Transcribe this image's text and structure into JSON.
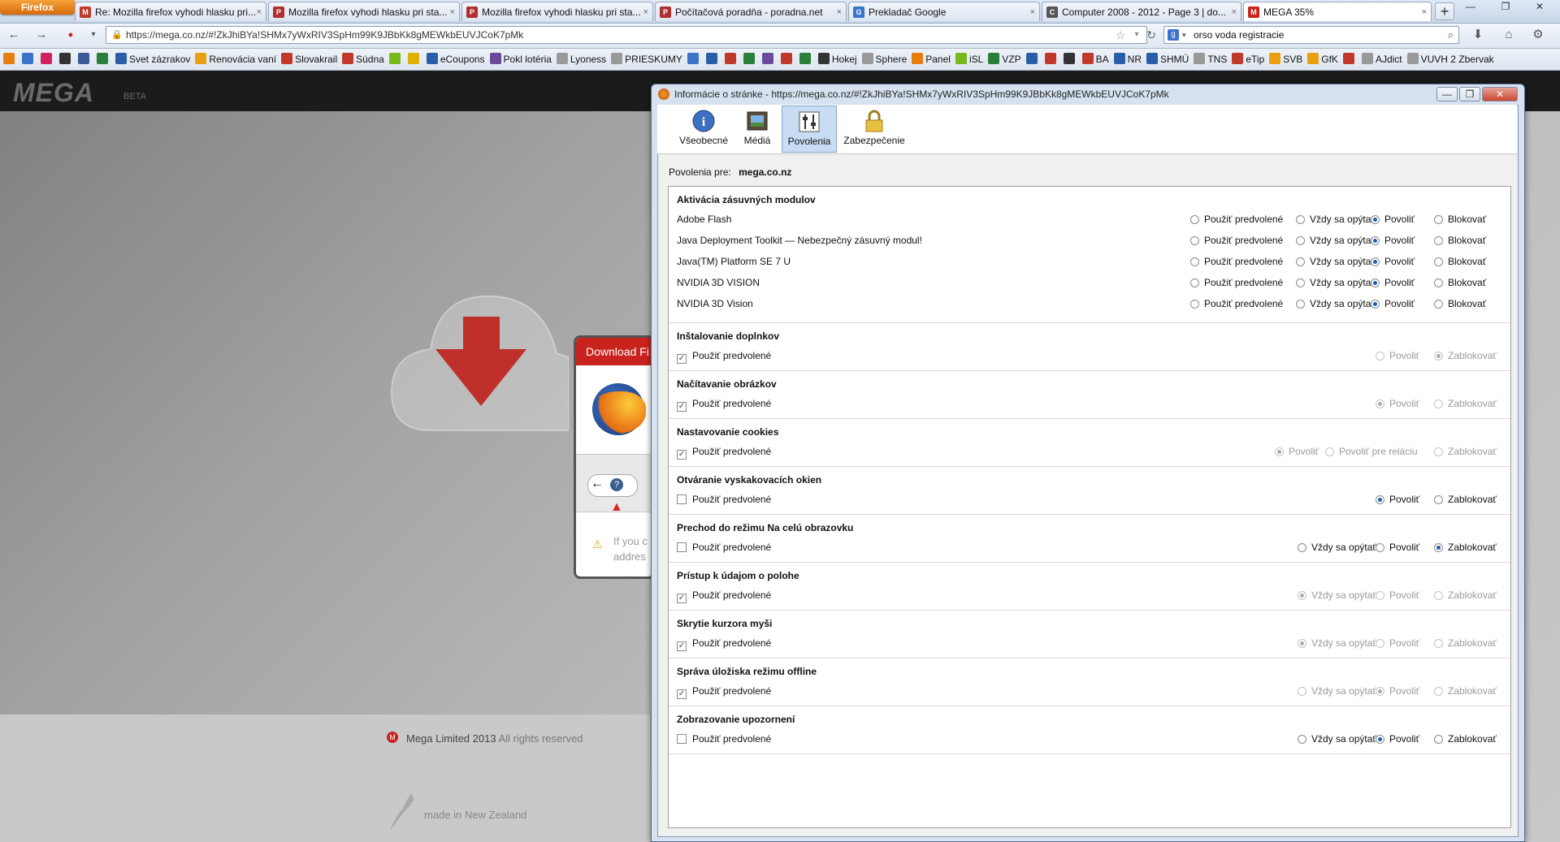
{
  "browser": {
    "ff_button": "Firefox",
    "tabs": [
      {
        "label": "Re: Mozilla firefox vyhodi hlasku pri...",
        "icon": "M",
        "color": "#c0392b"
      },
      {
        "label": "Mozilla firefox vyhodi hlasku pri sta...",
        "icon": "P",
        "color": "#b03030"
      },
      {
        "label": "Mozilla firefox vyhodi hlasku pri sta...",
        "icon": "P",
        "color": "#b03030"
      },
      {
        "label": "Počítačová poradňa - poradna.net",
        "icon": "P",
        "color": "#b03030"
      },
      {
        "label": "Prekladač Google",
        "icon": "G",
        "color": "#3a73c9"
      },
      {
        "label": "Computer 2008 - 2012 - Page 3 | do...",
        "icon": "C",
        "color": "#555555"
      },
      {
        "label": "MEGA 35%",
        "icon": "M",
        "color": "#c9231d"
      }
    ],
    "url": "https://mega.co.nz/#!ZkJhiBYa!SHMx7yWxRIV3SpHm99K9JBbKk8gMEWkbEUVJCoK7pMk",
    "search": "orso voda registracie",
    "bookmarks": [
      {
        "label": "",
        "color": "#e87d10"
      },
      {
        "label": "",
        "color": "#3b73c9"
      },
      {
        "label": "",
        "color": "#d02060"
      },
      {
        "label": "",
        "color": "#333333"
      },
      {
        "label": "",
        "color": "#3b5998"
      },
      {
        "label": "",
        "color": "#2a7f3a"
      },
      {
        "label": "Svet zázrakov",
        "color": "#2a5fa8"
      },
      {
        "label": "Renovácia vaní",
        "color": "#e8a010"
      },
      {
        "label": "Slovakrail",
        "color": "#c0392b"
      },
      {
        "label": "Súdna",
        "color": "#c0392b"
      },
      {
        "label": "",
        "color": "#77b81b"
      },
      {
        "label": "",
        "color": "#e0b000"
      },
      {
        "label": "eCoupons",
        "color": "#2a5fa8"
      },
      {
        "label": "Pokl lotéria",
        "color": "#6a4a9a"
      },
      {
        "label": "Lyoness",
        "color": "#999999"
      },
      {
        "label": "PRIESKUMY",
        "color": "#999999"
      },
      {
        "label": "",
        "color": "#3b73c9"
      },
      {
        "label": "",
        "color": "#2a5fa8"
      },
      {
        "label": "",
        "color": "#c0392b"
      },
      {
        "label": "",
        "color": "#2a7f3a"
      },
      {
        "label": "",
        "color": "#6a4a9a"
      },
      {
        "label": "",
        "color": "#c0392b"
      },
      {
        "label": "",
        "color": "#2a7f3a"
      },
      {
        "label": "Hokej",
        "color": "#333333"
      },
      {
        "label": "Sphere",
        "color": "#999999"
      },
      {
        "label": "Panel",
        "color": "#e87d10"
      },
      {
        "label": "iSL",
        "color": "#77b81b"
      },
      {
        "label": "VZP",
        "color": "#2a7f3a"
      },
      {
        "label": "",
        "color": "#2a5fa8"
      },
      {
        "label": "",
        "color": "#c0392b"
      },
      {
        "label": "",
        "color": "#333333"
      },
      {
        "label": "BA",
        "color": "#c0392b"
      },
      {
        "label": "NR",
        "color": "#2a5fa8"
      },
      {
        "label": "SHMÚ",
        "color": "#2a5fa8"
      },
      {
        "label": "TNS",
        "color": "#999999"
      },
      {
        "label": "eTip",
        "color": "#c0392b"
      },
      {
        "label": "SVB",
        "color": "#e8a010"
      },
      {
        "label": "GfK",
        "color": "#e8a010"
      },
      {
        "label": "",
        "color": "#c0392b"
      },
      {
        "label": "AJdict",
        "color": "#999999"
      },
      {
        "label": "VUVH 2 Zbervak",
        "color": "#999999"
      }
    ]
  },
  "mega": {
    "logo": "MEGA",
    "beta": "BETA",
    "popup_title": "Download Fi",
    "popup_text_1": "If you c",
    "popup_text_2": "addres",
    "footer": "Mega Limited 2013",
    "footer_rights": "All rights reserved",
    "made_in": "made in New Zealand"
  },
  "dialog": {
    "title": "Informácie o stránke - https://mega.co.nz/#!ZkJhiBYa!SHMx7yWxRIV3SpHm99K9JBbKk8gMEWkbEUVJCoK7pMk",
    "tabs": [
      "Všeobecné",
      "Médiá",
      "Povolenia",
      "Zabezpečenie"
    ],
    "perm_for_label": "Povolenia pre:",
    "perm_for_site": "mega.co.nz",
    "sections": [
      {
        "title": "Aktivácia zásuvných modulov",
        "rows": [
          {
            "label": "Adobe Flash",
            "options": [
              "Použiť predvolené",
              "Vždy sa opýtať",
              "Povoliť",
              "Blokovať"
            ],
            "selected": 2
          },
          {
            "label": "Java Deployment Toolkit — Nebezpečný zásuvný modul!",
            "options": [
              "Použiť predvolené",
              "Vždy sa opýtať",
              "Povoliť",
              "Blokovať"
            ],
            "selected": 2
          },
          {
            "label": "Java(TM) Platform SE 7 U",
            "options": [
              "Použiť predvolené",
              "Vždy sa opýtať",
              "Povoliť",
              "Blokovať"
            ],
            "selected": 2
          },
          {
            "label": "NVIDIA 3D VISION",
            "options": [
              "Použiť predvolené",
              "Vždy sa opýtať",
              "Povoliť",
              "Blokovať"
            ],
            "selected": 2
          },
          {
            "label": "NVIDIA 3D Vision",
            "options": [
              "Použiť predvolené",
              "Vždy sa opýtať",
              "Povoliť",
              "Blokovať"
            ],
            "selected": 2
          }
        ]
      },
      {
        "title": "Inštalovanie doplnkov",
        "use_default": "Použiť predvolené",
        "checked": true,
        "options": [
          "Povoliť",
          "Zablokovať"
        ],
        "selected": 1,
        "disabled": true
      },
      {
        "title": "Načítavanie obrázkov",
        "use_default": "Použiť predvolené",
        "checked": true,
        "options": [
          "Povoliť",
          "Zablokovať"
        ],
        "selected": 0,
        "disabled": true
      },
      {
        "title": "Nastavovanie cookies",
        "use_default": "Použiť predvolené",
        "checked": true,
        "options": [
          "Povoliť",
          "Povoliť pre reláciu",
          "Zablokovať"
        ],
        "selected": 0,
        "disabled": true
      },
      {
        "title": "Otváranie vyskakovacích okien",
        "use_default": "Použiť predvolené",
        "checked": false,
        "options": [
          "Povoliť",
          "Zablokovať"
        ],
        "selected": 0,
        "disabled": false
      },
      {
        "title": "Prechod do režimu Na celú obrazovku",
        "use_default": "Použiť predvolené",
        "checked": false,
        "options": [
          "Vždy sa opýtať",
          "Povoliť",
          "Zablokovať"
        ],
        "selected": 2,
        "disabled": false
      },
      {
        "title": "Prístup k údajom o polohe",
        "use_default": "Použiť predvolené",
        "checked": true,
        "options": [
          "Vždy sa opýtať",
          "Povoliť",
          "Zablokovať"
        ],
        "selected": 0,
        "disabled": true
      },
      {
        "title": "Skrytie kurzora myši",
        "use_default": "Použiť predvolené",
        "checked": true,
        "options": [
          "Vždy sa opýtať",
          "Povoliť",
          "Zablokovať"
        ],
        "selected": 0,
        "disabled": true
      },
      {
        "title": "Správa úložiska režimu offline",
        "use_default": "Použiť predvolené",
        "checked": true,
        "options": [
          "Vždy sa opýtať",
          "Povoliť",
          "Zablokovať"
        ],
        "selected": 1,
        "disabled": true
      },
      {
        "title": "Zobrazovanie upozornení",
        "use_default": "Použiť predvolené",
        "checked": false,
        "options": [
          "Vždy sa opýtať",
          "Povoliť",
          "Zablokovať"
        ],
        "selected": 1,
        "disabled": false
      }
    ]
  }
}
